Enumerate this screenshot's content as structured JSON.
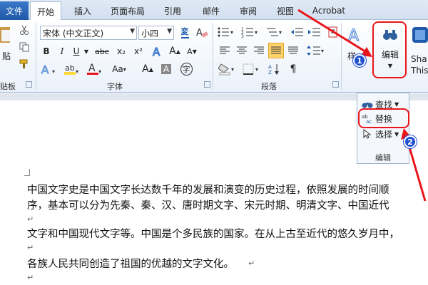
{
  "tabs": {
    "file": "文件",
    "items": [
      "开始",
      "插入",
      "页面布局",
      "引用",
      "邮件",
      "审阅",
      "视图",
      "Acrobat"
    ],
    "active": "开始"
  },
  "groups": {
    "clipboard_partial": "贴板",
    "paste_partial": "贴",
    "font": "字体",
    "paragraph": "段落",
    "editing": "编辑",
    "styles_partial": "样"
  },
  "font_controls": {
    "font_name": "宋体 (中文正文)",
    "font_size": "小四",
    "wen_icon": "wen-icon",
    "bold": "B",
    "italic": "I",
    "underline": "U",
    "strike": "abc",
    "subscript": "x₂",
    "superscript": "x²",
    "grow": "A",
    "shrink": "A",
    "case": "Aa",
    "char_border": "字",
    "shading": "A"
  },
  "editing_button": {
    "label": "编辑"
  },
  "share_partial": {
    "line1": "Sha",
    "line2": "This"
  },
  "edit_panel": {
    "find": "查找",
    "replace": "替换",
    "select": "选择",
    "group_label": "编辑"
  },
  "callouts": {
    "one": "1",
    "two": "2"
  },
  "document": {
    "lines": [
      "中国文字史是中国文字长达数千年的发展和演变的历史过程，依照发展的时间顺",
      "序，基本可以分为先秦、秦、汉、唐时期文字、宋元时期、明清文字、中国近代",
      "文字和中国现代文字等。中国是个多民族的国家。在从上古至近代的悠久岁月中，",
      "各族人民共同创造了祖国的优越的文字文化。"
    ],
    "paragraph_mark": "↵"
  },
  "colors": {
    "accent_red": "#e8151b",
    "callout_blue": "#1d4fd1",
    "highlight_yellow": "#ffd83a",
    "file_tab_blue": "#2b66b8"
  }
}
